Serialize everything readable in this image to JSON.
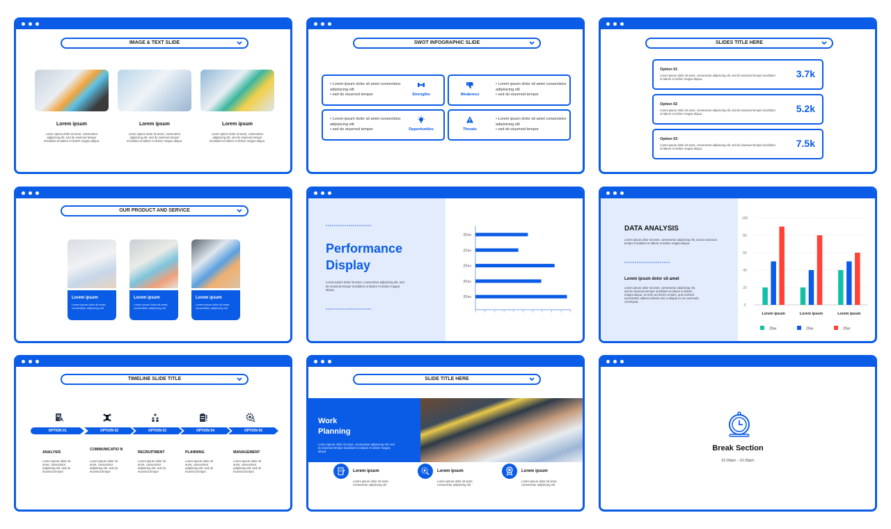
{
  "colors": {
    "brand": "#0a5be6",
    "tint": "#e3ecfd",
    "teal": "#13bfa6",
    "blue": "#0a5be6",
    "red": "#ff4136"
  },
  "slides": {
    "image_text": {
      "title": "IMAGE & TEXT SLIDE",
      "cards": [
        {
          "heading": "Lorem ipsum",
          "body": "Lorem ipsum dolor sit amet, consectetur adipiscing elit, sed do eiusmod tempor incididunt ut labore et dolore magna aliqua."
        },
        {
          "heading": "Lorem ipsum",
          "body": "Lorem ipsum dolor sit amet, consectetur adipiscing elit, sed do eiusmod tempor incididunt ut labore et dolore magna aliqua."
        },
        {
          "heading": "Lorem ipsum",
          "body": "Lorem ipsum dolor sit amet, consectetur adipiscing elit, sed do eiusmod tempor incididunt ut labore et dolore magna aliqua."
        }
      ]
    },
    "swot": {
      "title": "SWOT INFOGRAPHIC SLIDE",
      "quadrants": [
        {
          "label": "Strengths",
          "icon": "dumbbell-icon",
          "bullets": [
            "Lorem ipsum dolor sit amet consectetur adipisicing elit",
            "sed do eiusmod tempor"
          ]
        },
        {
          "label": "Weakness",
          "icon": "thumbs-down-icon",
          "bullets": [
            "Lorem ipsum dolor sit amet consectetur adipisicing elit",
            "sed do eiusmod tempor"
          ]
        },
        {
          "label": "Opportunities",
          "icon": "lightbulb-icon",
          "bullets": [
            "Lorem ipsum dolor sit amet consectetur adipisicing elit",
            "sed do eiusmod tempor"
          ]
        },
        {
          "label": "Threats",
          "icon": "warning-icon",
          "bullets": [
            "Lorem ipsum dolor sit amet consectetur adipisicing elit",
            "sed do eiusmod tempor"
          ]
        }
      ]
    },
    "options": {
      "title": "SLIDES TITLE HERE",
      "items": [
        {
          "heading": "Option 01",
          "body": "Lorem ipsum dolor sit amet, consectetur adipiscing elit, sed do eiusmod tempor incididunt ut labore et dolore magna aliqua.",
          "value": "3.7k"
        },
        {
          "heading": "Option 02",
          "body": "Lorem ipsum dolor sit amet, consectetur adipiscing elit, sed do eiusmod tempor incididunt ut labore et dolore magna aliqua.",
          "value": "5.2k"
        },
        {
          "heading": "Option 03",
          "body": "Lorem ipsum dolor sit amet, consectetur adipiscing elit, sed do eiusmod tempor incididunt ut labore et dolore magna aliqua.",
          "value": "7.5k"
        }
      ]
    },
    "product": {
      "title": "OUR PRODUCT AND SERVICE",
      "cards": [
        {
          "heading": "Lorem ipsum",
          "body": "Lorem ipsum dolor sit amet, consectetur adipiscing elit"
        },
        {
          "heading": "Lorem ipsum",
          "body": "Lorem ipsum dolor sit amet, consectetur adipiscing elit"
        },
        {
          "heading": "Lorem ipsum",
          "body": "Lorem ipsum dolor sit amet, consectetur adipiscing elit"
        }
      ]
    },
    "performance": {
      "title_line1": "Performance",
      "title_line2": "Display",
      "body": "Lorem ipsum dolor sit amet, consectetur adipiscing elit, sed do eiusmod tempor incididunt ut labore et dolore magna aliqua."
    },
    "data_analysis": {
      "title": "DATA ANALYSIS",
      "intro": "Lorem ipsum dolor sit amet, consectetur adipiscing elit, sed do eiusmod tempor incididunt ut labore et dolore magna aliqua.",
      "subheading": "Lorem ipsum dolor sit amet",
      "body": "Lorem ipsum dolor sit amet, consectetur adipiscing elit, sed do eiusmod tempor incididunt ut labore et dolore magna aliqua. Ut enim ad minim veniam, quis nostrud exercitation ullamco laboris nisi ut aliquip ex ea commodo consequat."
    },
    "timeline": {
      "title": "TIMELINE SLIDE TITLE",
      "steps": [
        {
          "option": "OPTION 01",
          "heading": "ANALYSIS",
          "icon": "document-search-icon",
          "body": "Lorem ipsum dolor sit amet, consectetur adipiscing elit, sed do eiusmod tempor"
        },
        {
          "option": "OPTION 02",
          "heading": "COMMUNICATIO N",
          "icon": "network-icon",
          "body": "Lorem ipsum dolor sit amet, consectetur adipiscing elit, sed do eiusmod tempor"
        },
        {
          "option": "OPTION 03",
          "heading": "RECRUITMENT",
          "icon": "people-idea-icon",
          "body": "Lorem ipsum dolor sit amet, consectetur adipiscing elit, sed do eiusmod tempor"
        },
        {
          "option": "OPTION 04",
          "heading": "PLANNING",
          "icon": "clipboard-icon",
          "body": "Lorem ipsum dolor sit amet, consectetur adipiscing elit, sed do eiusmod tempor"
        },
        {
          "option": "OPTION 05",
          "heading": "MANAGEMENT",
          "icon": "gear-search-icon",
          "body": "Lorem ipsum dolor sit amet, consectetur adipiscing elit, sed do eiusmod tempor"
        }
      ]
    },
    "work_planning": {
      "title": "SLIDE TITLE HERE",
      "heading_line1": "Work",
      "heading_line2": "Planning",
      "body": "Lorem ipsum dolor sit amet, consectetur adipiscing elit, sed do eiusmod tempor incididunt ut labore et dolore magna aliqua.",
      "features": [
        {
          "heading": "Lorem ipsum",
          "body": "Lorem ipsum dolor sit amet, consectetur adipiscing elit",
          "icon": "edit-document-icon"
        },
        {
          "heading": "Lorem ipsum",
          "body": "Lorem ipsum dolor sit amet, consectetur adipiscing elit",
          "icon": "search-gear-icon"
        },
        {
          "heading": "Lorem ipsum",
          "body": "Lorem ipsum dolor sit amet, consectetur adipiscing elit",
          "icon": "award-icon"
        }
      ]
    },
    "break": {
      "title": "Break Section",
      "time": "01:00pm – 01:30pm",
      "icon": "stopwatch-icon"
    }
  },
  "chart_data": [
    {
      "type": "bar",
      "orientation": "horizontal",
      "categories": [
        "20xx",
        "20xx",
        "20xx",
        "20xx",
        "20xx"
      ],
      "values": [
        5.5,
        4.5,
        8.3,
        6.9,
        9.6
      ],
      "xlim": [
        0,
        10
      ],
      "title": "",
      "xlabel": "",
      "ylabel": "",
      "grid": false
    },
    {
      "type": "bar",
      "categories": [
        "Lorem ipsum",
        "Lorem ipsum",
        "Lorem ipsum"
      ],
      "series": [
        {
          "name": "20xx",
          "color": "#13bfa6",
          "values": [
            20,
            20,
            40
          ]
        },
        {
          "name": "20xx",
          "color": "#0a5be6",
          "values": [
            50,
            40,
            50
          ]
        },
        {
          "name": "20xx",
          "color": "#ff4136",
          "values": [
            90,
            80,
            60
          ]
        }
      ],
      "yticks": [
        0,
        20,
        40,
        60,
        80,
        100
      ],
      "ylim": [
        0,
        100
      ],
      "title": "",
      "xlabel": "",
      "ylabel": "",
      "grid": true,
      "legend": "bottom"
    }
  ]
}
